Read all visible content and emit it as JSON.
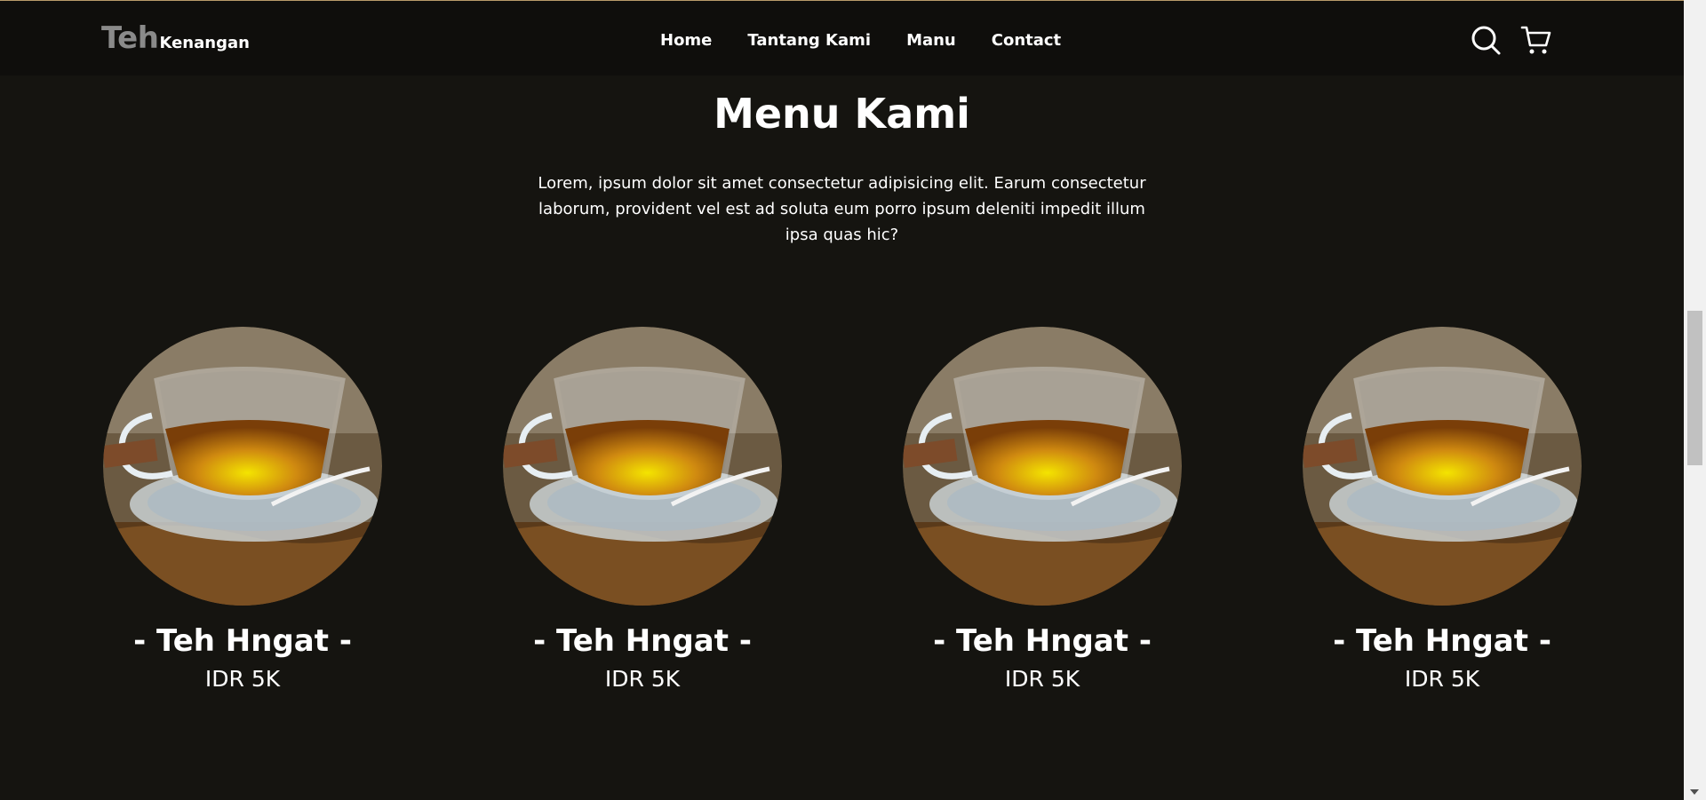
{
  "navbar": {
    "logo_primary": "Teh",
    "logo_secondary": "Kenangan",
    "links": [
      {
        "label": "Home"
      },
      {
        "label": "Tantang Kami"
      },
      {
        "label": "Manu"
      },
      {
        "label": "Contact"
      }
    ],
    "icons": [
      "search-icon",
      "cart-icon"
    ]
  },
  "menu_section": {
    "title": "Menu Kami",
    "description": "Lorem, ipsum dolor sit amet consectetur adipisicing elit. Earum consectetur laborum, provident vel est ad soluta eum porro ipsum deleniti impedit illum ipsa quas hic?",
    "items": [
      {
        "name": "- Teh Hngat -",
        "price": "IDR 5K"
      },
      {
        "name": "- Teh Hngat -",
        "price": "IDR 5K"
      },
      {
        "name": "- Teh Hngat -",
        "price": "IDR 5K"
      },
      {
        "name": "- Teh Hngat -",
        "price": "IDR 5K"
      }
    ]
  },
  "colors": {
    "background": "#151410",
    "navbar": "#0f0e0c",
    "text": "#ffffff",
    "logo_muted": "#8a8a8a",
    "scrollbar_track": "#f1f1f1",
    "scrollbar_thumb": "#c1c1c1"
  }
}
